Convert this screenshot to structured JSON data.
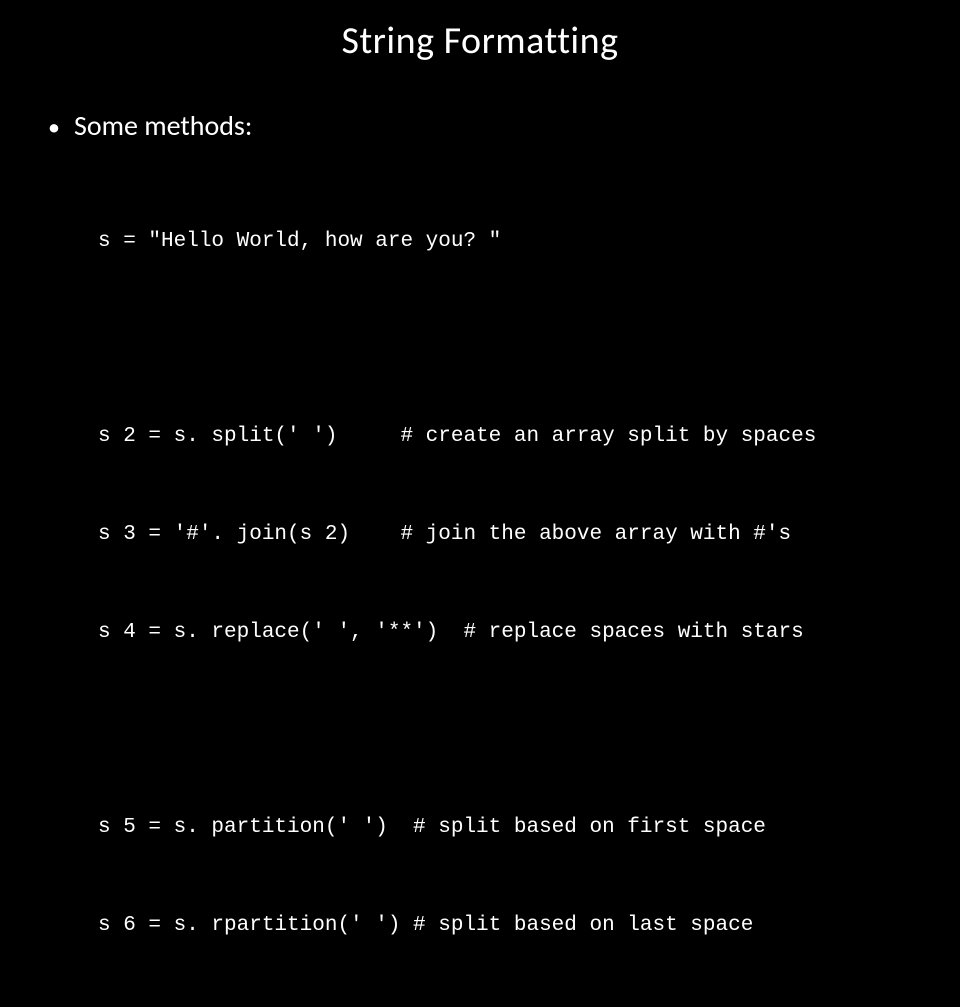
{
  "slide": {
    "title": "String Formatting",
    "bullet": {
      "marker": "•",
      "text": "Some methods:"
    },
    "code": {
      "l1": "s = \"Hello World, how are you? \"",
      "l2": "s 2 = s. split(' ')     # create an array split by spaces",
      "l3": "s 3 = '#'. join(s 2)    # join the above array with #'s",
      "l4": "s 4 = s. replace(' ', '**')  # replace spaces with stars",
      "l5": "s 5 = s. partition(' ')  # split based on first space",
      "l6": "s 6 = s. rpartition(' ') # split based on last space"
    }
  }
}
